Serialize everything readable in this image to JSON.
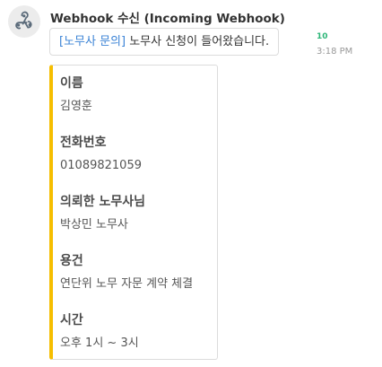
{
  "message": {
    "sender": "Webhook 수신 (Incoming Webhook)",
    "tag": "[노무사 문의]",
    "text": " 노무사 신청이 들어왔습니다.",
    "unread_count": "10",
    "time": "3:18 PM"
  },
  "card": {
    "accent_color": "#f6be00",
    "fields": [
      {
        "label": "이름",
        "value": "김영훈"
      },
      {
        "label": "전화번호",
        "value": "01089821059"
      },
      {
        "label": "의뢰한 노무사님",
        "value": "박상민 노무사"
      },
      {
        "label": "용건",
        "value": "연단위 노무 자문 계약 체결"
      },
      {
        "label": "시간",
        "value": "오후 1시 ~ 3시"
      }
    ]
  },
  "icons": {
    "avatar": "webhook-icon"
  }
}
